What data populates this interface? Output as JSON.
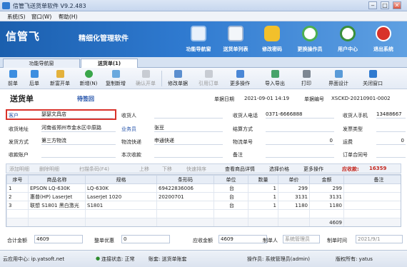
{
  "window": {
    "title": "信管飞送货单软件 V9.2.483"
  },
  "menu": [
    "系统(S)",
    "窗口(W)",
    "帮助(H)"
  ],
  "banner": {
    "logo": "信管飞",
    "slogan": "精细化管理软件",
    "nav": [
      "功能导航窗",
      "送货单列表",
      "修改密码",
      "更换操作员",
      "用户中心",
      "退出系统"
    ],
    "colors": {
      "bg": "#2f7ad0",
      "accent": "#ffffff"
    }
  },
  "tabs": [
    "功能导航窗",
    "送货单(1)"
  ],
  "toolbar": [
    "前单",
    "后单",
    "新富开单",
    "新增(N)",
    "复制新增",
    "确认开单",
    "修改单据",
    "引用订单",
    "更多操作",
    "导入导出",
    "打印",
    "界面设计",
    "关闭窗口"
  ],
  "header": {
    "title": "送货单",
    "status": "待签回",
    "date_label": "单据日期",
    "date_value": "2021-09-01 14:19",
    "no_label": "单据编号",
    "no_value": "XSCKD-20210901-0002"
  },
  "form": {
    "customer_label": "客户",
    "customer_value": "瑟瑟文具店",
    "consignee_label": "收货人",
    "consignee_value": "",
    "consignee_phone_label": "收货人电话",
    "consignee_phone_value": "0371-6666888",
    "consignee_mobile_label": "收货人手机",
    "consignee_mobile_value": "13488667",
    "address_label": "收货地址",
    "address_value": "河南省郑州市金水区中原路",
    "sales_label": "业务员",
    "sales_value": "张豆",
    "settle_label": "结算方式",
    "settle_value": "",
    "invoice_label": "发票类型",
    "invoice_value": "",
    "ship_label": "发货方式",
    "ship_value": "第三方物流",
    "logistics_label": "物流快递",
    "logistics_value": "申通快递",
    "tracking_label": "物流单号",
    "tracking_value": "0",
    "freight_label": "运费",
    "freight_value": "0",
    "account_label": "收款账户",
    "account_value": "",
    "received_label": "本次收款",
    "received_value": "",
    "remark_label": "备注",
    "remark_value": "",
    "order_no_label": "订单合同号",
    "order_no_value": ""
  },
  "grid_toolbar": {
    "items": [
      "添加明细",
      "删除明细",
      "扫描条码(F4)",
      "上移",
      "下移",
      "快速排序",
      "查看商品详情",
      "选择价格",
      "更多操作"
    ],
    "receivable_label": "应收款:",
    "receivable_value": "16359"
  },
  "grid": {
    "columns": [
      "序号",
      "商品名称",
      "规格",
      "条形码",
      "单位",
      "数量",
      "单价",
      "金额",
      "备注"
    ],
    "rows": [
      [
        "1",
        "EPSON LQ-630K",
        "LQ-630K",
        "69422836006",
        "台",
        "1",
        "299",
        "299",
        ""
      ],
      [
        "2",
        "惠普(HP) LaserJet",
        "LaserJet 1020",
        "20200701",
        "台",
        "1",
        "3131",
        "3131",
        ""
      ],
      [
        "3",
        "联想 S1801 黑白激光",
        "S1801",
        "",
        "台",
        "1",
        "1180",
        "1180",
        ""
      ]
    ],
    "total": "4609"
  },
  "totals": {
    "sum_label": "合计金额",
    "sum_value": "4609",
    "discount_label": "整单优惠",
    "discount_value": "0",
    "receivable_label": "应收金额",
    "receivable_value": "4609",
    "maker_label": "制单人",
    "maker_value": "系统管理员",
    "maketime_label": "制单时间",
    "maketime_value": "2021/9/1"
  },
  "statusbar": {
    "cloud": "云应用中心: ip.yatsoft.net",
    "conn": "连接状态: 正常",
    "account": "账套: 送货单账套",
    "operator": "操作员: 系统管理员(admin)",
    "license": "版权所有: yatus"
  }
}
